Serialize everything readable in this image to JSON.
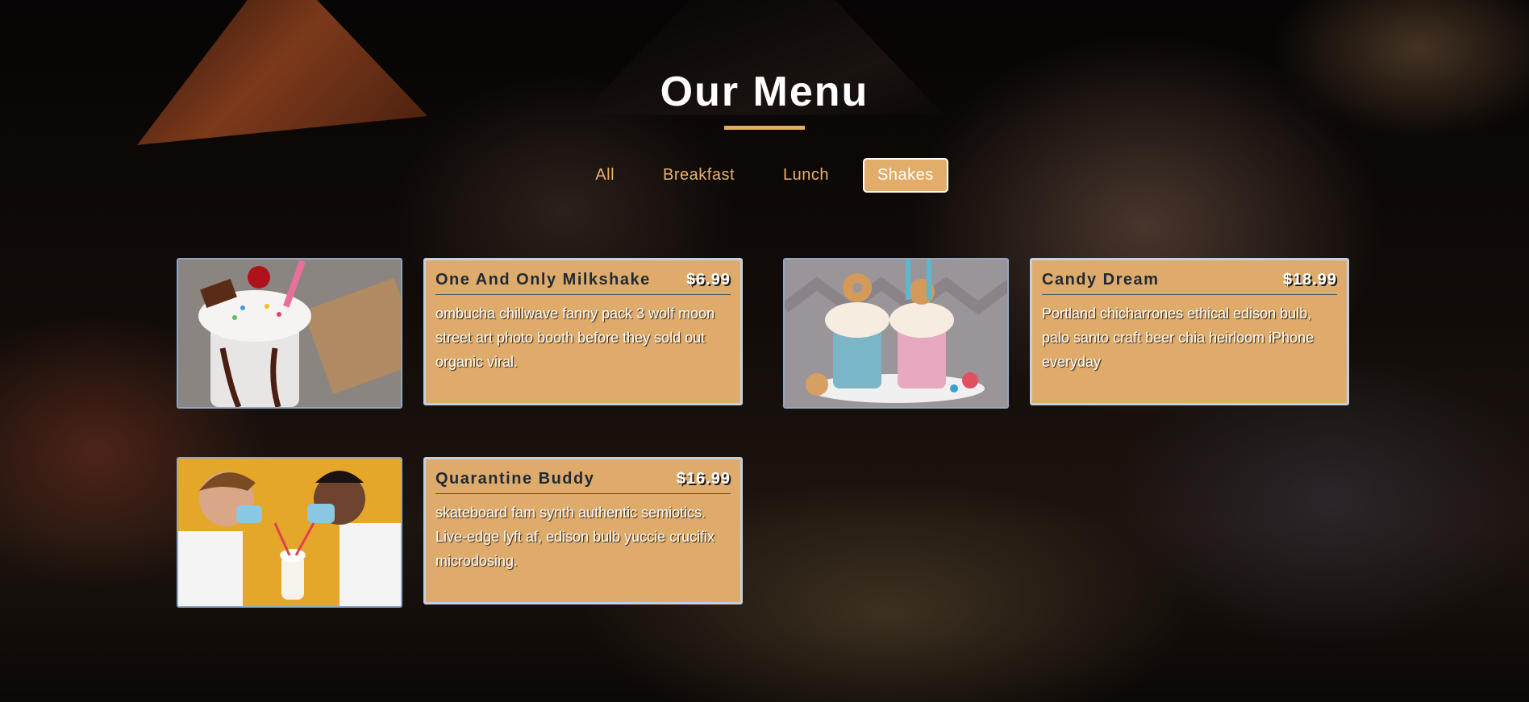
{
  "section": {
    "title": "Our Menu",
    "accent_color": "#e3ac63"
  },
  "filters": [
    {
      "label": "All",
      "active": false
    },
    {
      "label": "Breakfast",
      "active": false
    },
    {
      "label": "Lunch",
      "active": false
    },
    {
      "label": "Shakes",
      "active": true
    }
  ],
  "items": [
    {
      "name": "One And Only Milkshake",
      "price": "$6.99",
      "description": "ombucha chillwave fanny pack 3 wolf moon street art photo booth before they sold out organic viral.",
      "photo": "milkshake-with-cherry-photo"
    },
    {
      "name": "Candy Dream",
      "price": "$18.99",
      "description": "Portland chicharrones ethical edison bulb, palo santo craft beer chia heirloom iPhone everyday",
      "photo": "candy-shakes-with-donuts-photo"
    },
    {
      "name": "Quarantine Buddy",
      "price": "$16.99",
      "description": "skateboard fam synth authentic semiotics. Live-edge lyft af, edison bulb yuccie crucifix microdosing.",
      "photo": "two-people-masks-sharing-shake-photo"
    }
  ],
  "colors": {
    "card_bg": "#deab6a",
    "card_border": "#c3d0e0",
    "photo_border": "#8fa6c4",
    "filter_text": "#e9b26c",
    "filter_active_bg": "#e2ac6a"
  }
}
